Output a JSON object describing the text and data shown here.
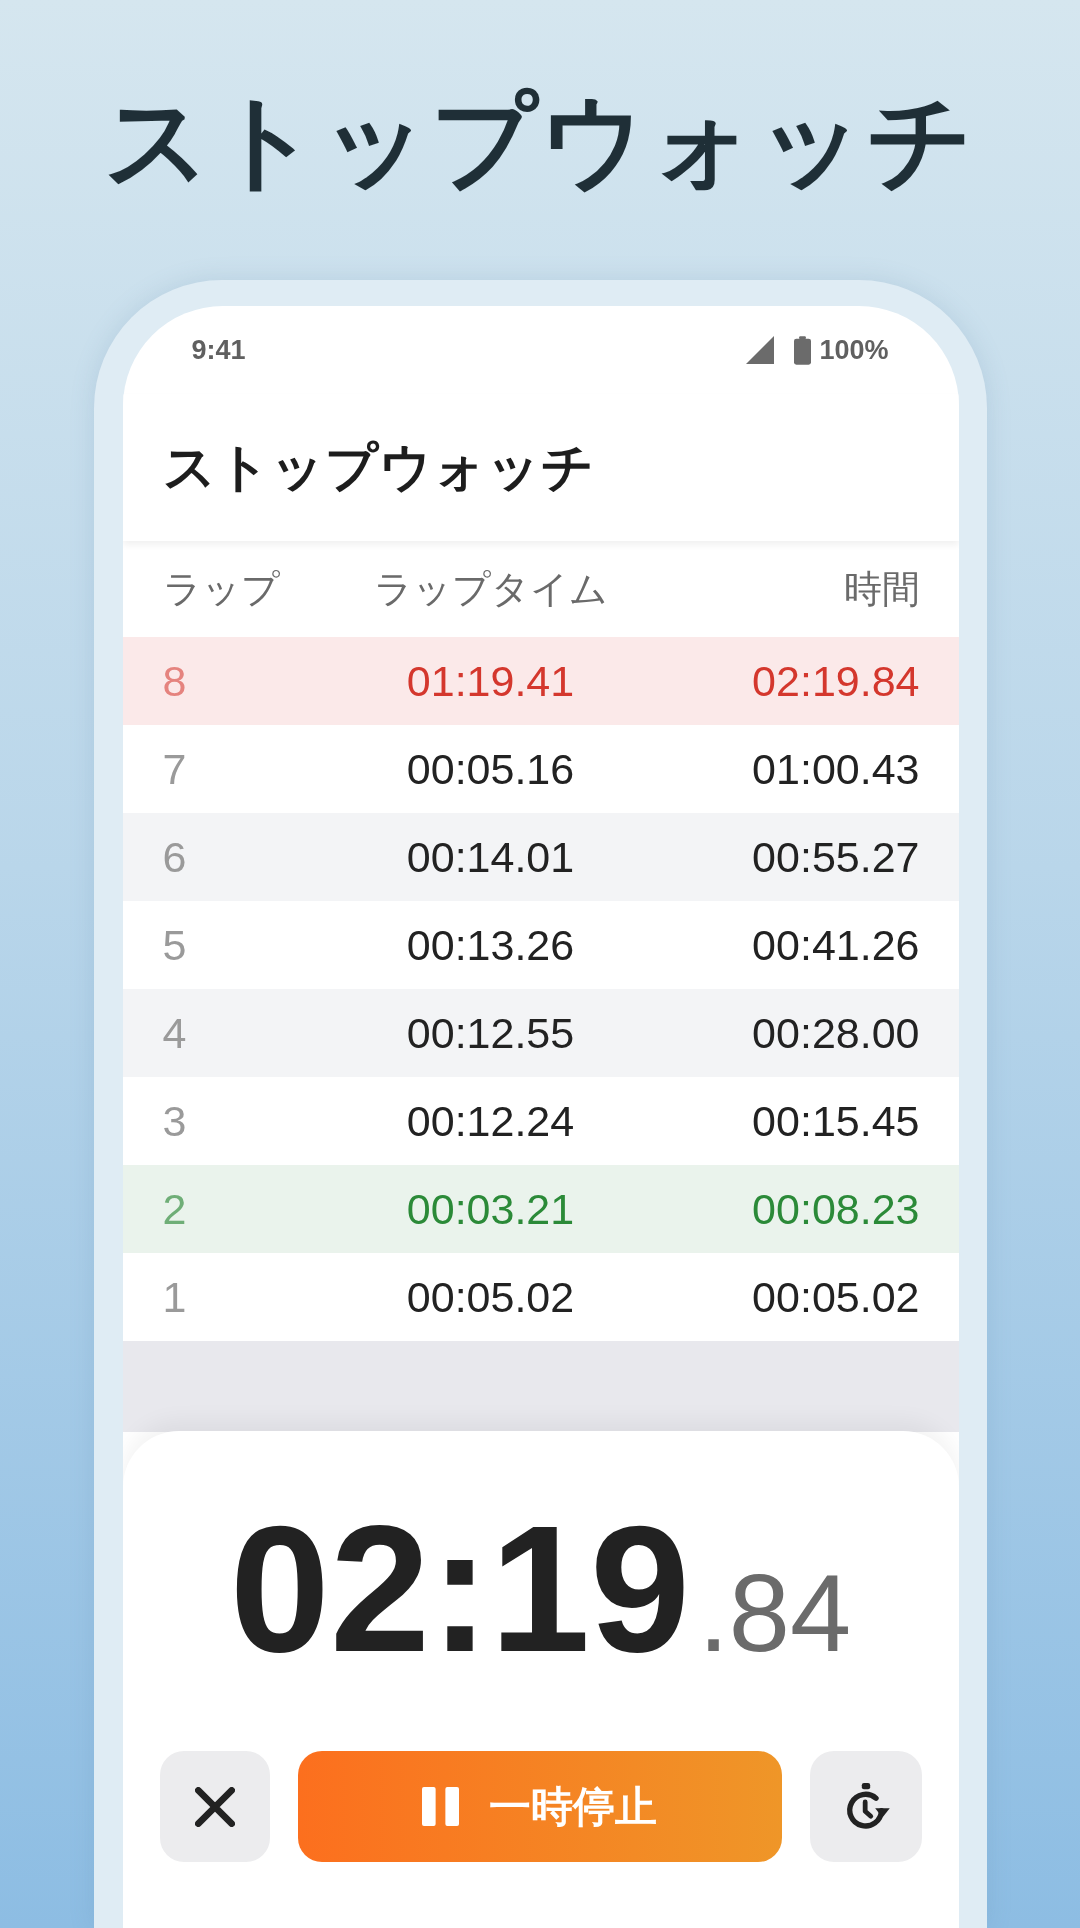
{
  "headline": "ストップウォッチ",
  "status_bar": {
    "time": "9:41",
    "battery": "100%"
  },
  "app_bar": {
    "title": "ストップウォッチ"
  },
  "lap_table": {
    "columns": [
      "ラップ",
      "ラップタイム",
      "時間"
    ],
    "rows": [
      {
        "lap": "8",
        "lap_time": "01:19.41",
        "total": "02:19.84",
        "kind": "slowest"
      },
      {
        "lap": "7",
        "lap_time": "00:05.16",
        "total": "01:00.43",
        "kind": "normal"
      },
      {
        "lap": "6",
        "lap_time": "00:14.01",
        "total": "00:55.27",
        "kind": "normal"
      },
      {
        "lap": "5",
        "lap_time": "00:13.26",
        "total": "00:41.26",
        "kind": "normal"
      },
      {
        "lap": "4",
        "lap_time": "00:12.55",
        "total": "00:28.00",
        "kind": "normal"
      },
      {
        "lap": "3",
        "lap_time": "00:12.24",
        "total": "00:15.45",
        "kind": "normal"
      },
      {
        "lap": "2",
        "lap_time": "00:03.21",
        "total": "00:08.23",
        "kind": "fastest"
      },
      {
        "lap": "1",
        "lap_time": "00:05.02",
        "total": "00:05.02",
        "kind": "normal"
      }
    ]
  },
  "timer": {
    "main": "02:19",
    "fraction": ".84"
  },
  "controls": [
    {
      "kind": "reset"
    },
    {
      "kind": "pause",
      "label": "一時停止"
    },
    {
      "kind": "lap"
    }
  ]
}
